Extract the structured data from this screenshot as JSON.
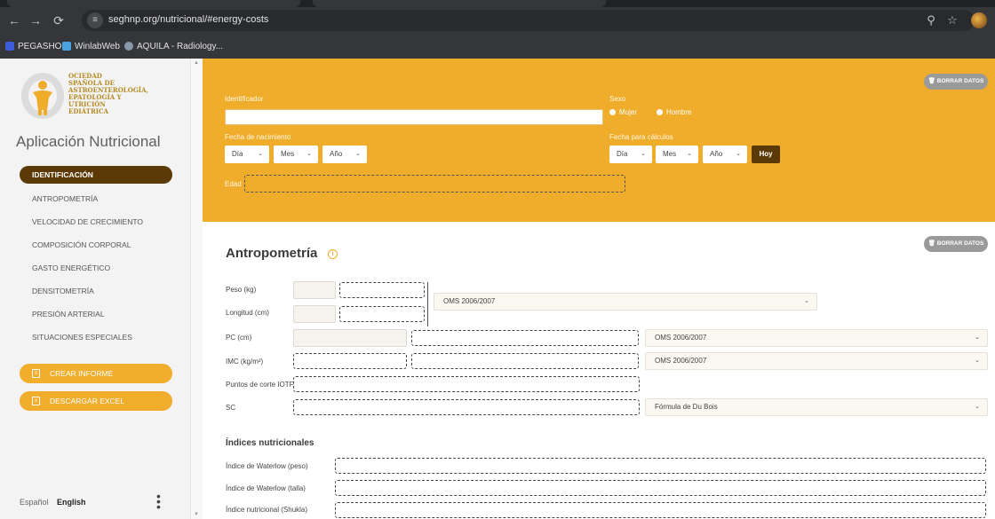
{
  "browser": {
    "url": "seghnp.org/nutricional/#energy-costs",
    "bookmarks": [
      {
        "label": "PEGASHO",
        "color": "#3b5bdb"
      },
      {
        "label": "WinlabWeb",
        "color": "#4aa3df"
      },
      {
        "label": "AQUILA - Radiology...",
        "color": "#8899aa"
      }
    ]
  },
  "sidebar": {
    "logo_lines": [
      "OCIEDAD",
      "SPAÑOLA DE",
      "ASTROENTEROLOGÍA,",
      "EPATOLOGÍA Y",
      "UTRICIÓN",
      "EDIÁTRICA"
    ],
    "app_title": "Aplicación Nutricional",
    "nav": [
      {
        "label": "IDENTIFICACIÓN",
        "active": true
      },
      {
        "label": "ANTROPOMETRÍA",
        "active": false
      },
      {
        "label": "VELOCIDAD DE CRECIMIENTO",
        "active": false
      },
      {
        "label": "COMPOSICIÓN CORPORAL",
        "active": false
      },
      {
        "label": "GASTO ENERGÉTICO",
        "active": false
      },
      {
        "label": "DENSITOMETRÍA",
        "active": false
      },
      {
        "label": "PRESIÓN ARTERIAL",
        "active": false
      },
      {
        "label": "SITUACIONES ESPECIALES",
        "active": false
      }
    ],
    "create_report": "CREAR INFORME",
    "download_excel": "DESCARGAR EXCEL",
    "lang_es": "Español",
    "lang_en": "English"
  },
  "identification": {
    "clear_label": "BORRAR DATOS",
    "identifier_label": "Identificador",
    "identifier_value": "",
    "sex_label": "Sexo",
    "sex_female": "Mujer",
    "sex_male": "Hombre",
    "birth_label": "Fecha de nacimiento",
    "calc_date_label": "Fecha para cálculos",
    "day": "Día",
    "month": "Mes",
    "year": "Año",
    "today": "Hoy",
    "age_label": "Edad"
  },
  "anthropometry": {
    "title": "Antropometría",
    "clear_label": "BORRAR DATOS",
    "weight_label": "Peso (kg)",
    "length_label": "Longitud (cm)",
    "ref_weight_length": "OMS 2006/2007",
    "pc_label": "PC (cm)",
    "ref_pc": "OMS 2006/2007",
    "bmi_label": "IMC (kg/m²)",
    "ref_bmi": "OMS 2006/2007",
    "iotf_label": "Puntos de corte IOTF",
    "sc_label": "SC",
    "sc_formula": "Fórmula de Du Bois"
  },
  "nutritional_indices": {
    "title": "Índices nutricionales",
    "waterlow_weight": "Índice de Waterlow (peso)",
    "waterlow_height": "Índice de Waterlow (talla)",
    "shukla": "Índice nutricional (Shukla)"
  }
}
